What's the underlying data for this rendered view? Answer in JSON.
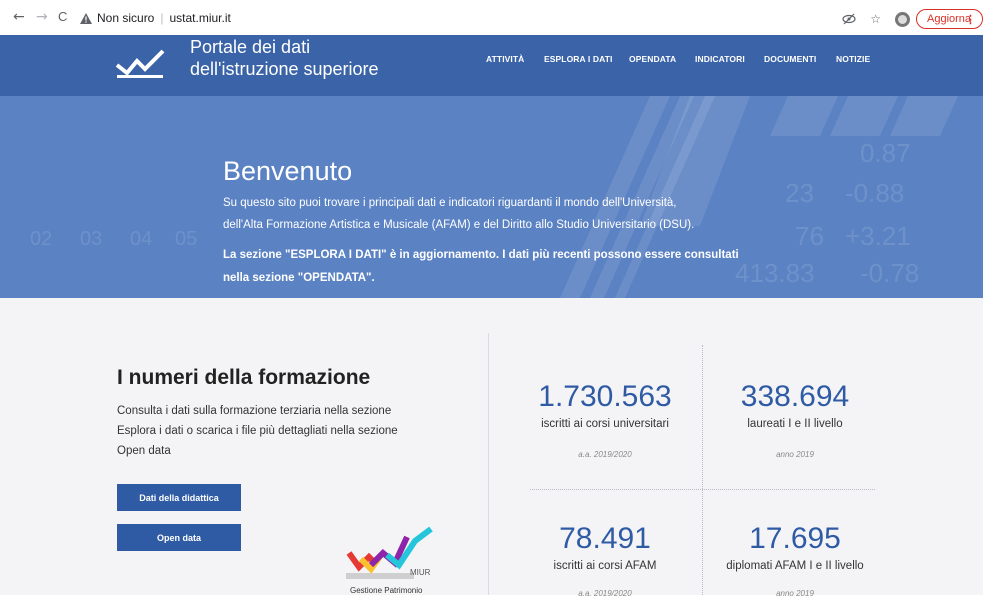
{
  "browser": {
    "back": "←",
    "forward": "→",
    "reload": "C",
    "security_label": "Non sicuro",
    "url": "ustat.miur.it",
    "update_label": "Aggiorna"
  },
  "header": {
    "title_line1": "Portale dei dati",
    "title_line2": "dell'istruzione superiore",
    "nav": [
      "ATTIVITÀ",
      "ESPLORA I DATI",
      "OPENDATA",
      "INDICATORI",
      "DOCUMENTI",
      "NOTIZIE"
    ]
  },
  "hero": {
    "title": "Benvenuto",
    "line1": "Su questo sito puoi trovare i principali dati e indicatori riguardanti il mondo dell'Università,",
    "line2": "dell'Alta Formazione Artistica e Musicale (AFAM) e del Diritto allo Studio Universitario (DSU).",
    "notice1": "La sezione \"ESPLORA I DATI\" è in aggiornamento. I dati più recenti possono essere consultati",
    "notice2": "nella sezione \"OPENDATA\".",
    "bg_numbers": [
      "0.87",
      "-0.88",
      "+3.21",
      "-0.78",
      "413.83",
      "76",
      "23",
      "02",
      "03",
      "04",
      "05"
    ]
  },
  "numbers": {
    "title": "I numeri della formazione",
    "desc1": "Consulta i dati sulla formazione terziaria nella sezione",
    "desc2": "Esplora i dati o scarica i file più dettagliati nella sezione",
    "desc3": "Open data",
    "btn_didattica": "Dati della didattica",
    "btn_opendata": "Open data",
    "stats": [
      {
        "value": "1.730.563",
        "label": "iscritti ai corsi universitari",
        "year": "a.a. 2019/2020"
      },
      {
        "value": "338.694",
        "label": "laureati I e II livello",
        "year": "anno 2019"
      },
      {
        "value": "78.491",
        "label": "iscritti ai corsi AFAM",
        "year": "a.a. 2019/2020"
      },
      {
        "value": "17.695",
        "label": "diplomati AFAM I e II livello",
        "year": "anno 2019"
      }
    ],
    "miur_label": "MIUR",
    "miur_sub": "Gestione Patrimonio"
  },
  "colors": {
    "header_bg": "#3a63a8",
    "hero_bg": "#5b82c3",
    "accent_blue": "#2f5ba5",
    "update_red": "#d93025"
  }
}
